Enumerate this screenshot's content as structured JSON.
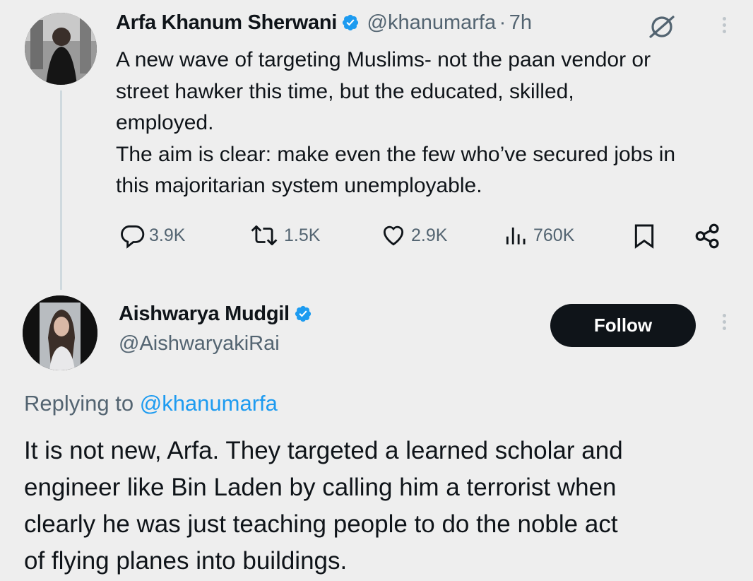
{
  "tweet": {
    "author_name": "Arfa Khanum Sherwani",
    "author_handle": "@khanumarfa",
    "separator": "·",
    "time": "7h",
    "text_lines": [
      "A new wave of targeting Muslims- not the paan vendor or",
      "street hawker this time, but the educated, skilled,",
      "employed.",
      "The aim is clear: make even the few who’ve secured jobs in",
      "this majoritarian system unemployable."
    ],
    "actions": {
      "replies": "3.9K",
      "reposts": "1.5K",
      "likes": "2.9K",
      "views": "760K"
    }
  },
  "reply": {
    "author_name": "Aishwarya Mudgil",
    "author_handle": "@AishwaryakiRai",
    "follow_label": "Follow",
    "replying_prefix": "Replying to",
    "replying_to": "@khanumarfa",
    "text_lines": [
      "It is not new, Arfa. They targeted a learned scholar and",
      "engineer like Bin Laden by calling him a terrorist when",
      "clearly he was just teaching people to do the noble act",
      "of flying planes into buildings."
    ]
  },
  "icons": {
    "verified": "verified-badge-icon",
    "grok": "grok-icon",
    "more": "more-options-icon",
    "reply": "reply-icon",
    "repost": "repost-icon",
    "like": "like-icon",
    "views": "views-icon",
    "bookmark": "bookmark-icon",
    "share": "share-icon"
  },
  "colors": {
    "background": "#eeeeee",
    "verified": "#1d9bf0",
    "link": "#1d9bf0",
    "follow_button": "#0f1419",
    "secondary_text": "#536471"
  }
}
